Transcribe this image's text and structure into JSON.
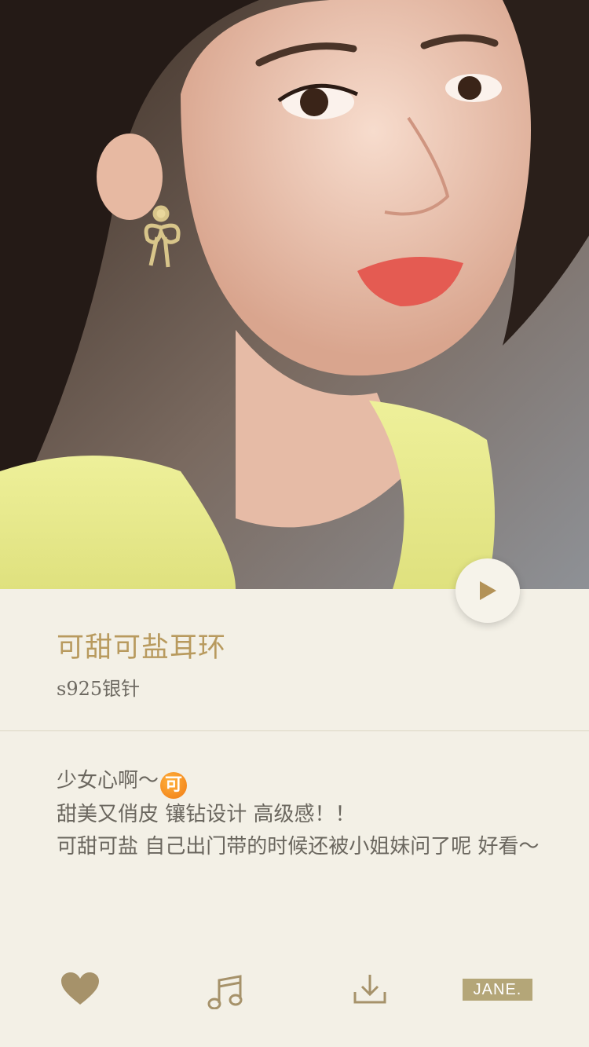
{
  "product": {
    "title": "可甜可盐耳环",
    "subtitle": "s925银针"
  },
  "description": {
    "line1": "少女心啊～",
    "emoji_text": "可",
    "line2": "甜美又俏皮 镶钻设计 高级感！！",
    "line3": "可甜可盐 自己出门带的时候还被小姐妹问了呢 好看～"
  },
  "toolbar": {
    "like_icon": "heart-icon",
    "music_icon": "music-note-icon",
    "download_icon": "download-icon",
    "brand_label": "JANE."
  },
  "colors": {
    "background": "#f3f0e6",
    "accent_gold": "#b89a5e",
    "icon_gold": "#a6926a",
    "badge": "#b4a678"
  }
}
